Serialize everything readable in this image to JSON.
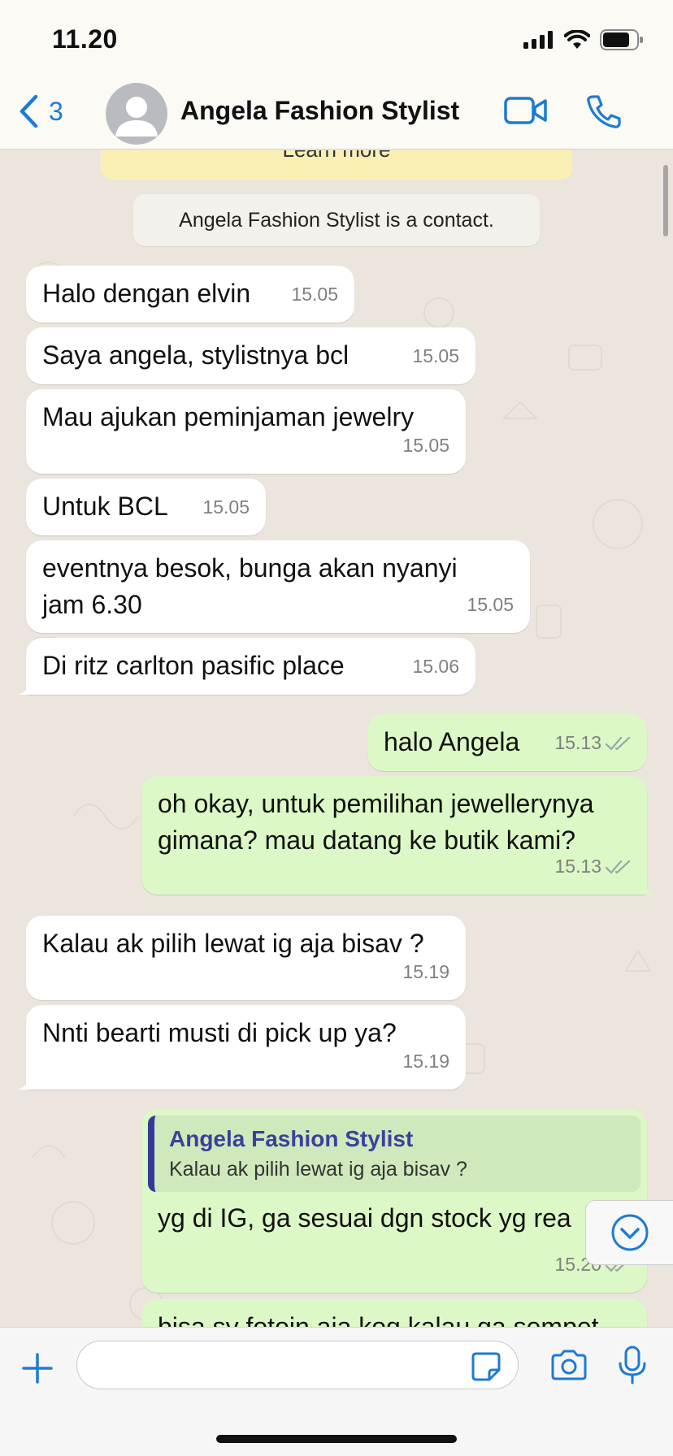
{
  "status_bar": {
    "time": "11.20"
  },
  "header": {
    "back_count": "3",
    "contact_name": "Angela Fashion Stylist"
  },
  "chat": {
    "banner_text": "Learn more",
    "system_message": "Angela Fashion Stylist is a contact.",
    "messages": [
      {
        "dir": "in",
        "text": "Halo dengan elvin",
        "time": "15.05"
      },
      {
        "dir": "in",
        "text": "Saya angela, stylistnya bcl",
        "time": "15.05"
      },
      {
        "dir": "in",
        "text": "Mau ajukan peminjaman jewelry",
        "time": "15.05"
      },
      {
        "dir": "in",
        "text": "Untuk BCL",
        "time": "15.05"
      },
      {
        "dir": "in",
        "text": "eventnya besok, bunga akan nyanyi jam 6.30",
        "time": "15.05"
      },
      {
        "dir": "in",
        "text": "Di ritz carlton pasific place",
        "time": "15.06"
      },
      {
        "dir": "out",
        "text": "halo Angela",
        "time": "15.13"
      },
      {
        "dir": "out",
        "text": "oh okay, untuk pemilihan jewellerynya gimana? mau datang ke butik kami?",
        "time": "15.13"
      },
      {
        "dir": "in",
        "text": "Kalau ak pilih lewat ig aja bisav ?",
        "time": "15.19"
      },
      {
        "dir": "in",
        "text": "Nnti bearti musti di pick up ya?",
        "time": "15.19"
      },
      {
        "dir": "out",
        "text": "yg di IG, ga sesuai dgn stock yg rea",
        "time": "15.20",
        "quote": {
          "name": "Angela Fashion Stylist",
          "text": "Kalau ak pilih lewat ig aja bisav ?"
        }
      },
      {
        "dir": "out",
        "text": "bisa sy fotoin aja koq kalau ga sempet"
      }
    ]
  },
  "input": {
    "placeholder": ""
  },
  "colors": {
    "accent": "#1e7bd1",
    "incoming_bubble": "#ffffff",
    "outgoing_bubble": "#dcf8c6",
    "chat_background": "#ebe5dd"
  }
}
